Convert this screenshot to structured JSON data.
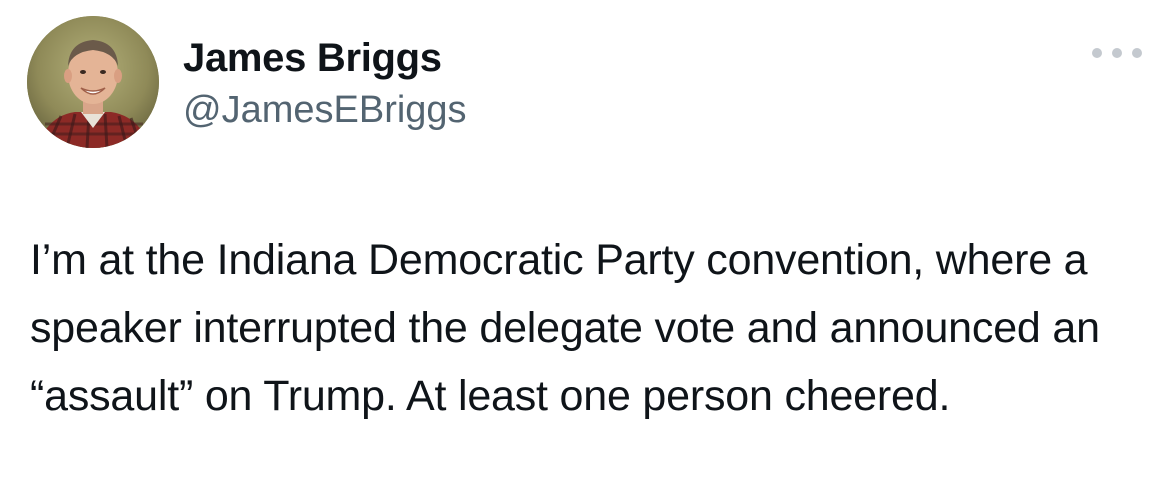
{
  "tweet": {
    "author": {
      "display_name": "James Briggs",
      "handle": "@JamesEBriggs",
      "avatar_icon": "user-avatar-photo"
    },
    "more_icon": "more-options-icon",
    "text": "I’m at the Indiana Democratic Party convention, where a speaker interrupted the delegate vote and announced an “assault” on Trump. At least one person cheered."
  },
  "colors": {
    "text_primary": "#0f1419",
    "text_secondary": "#536471",
    "more_dots": "#c4c9cf",
    "background": "#ffffff"
  }
}
